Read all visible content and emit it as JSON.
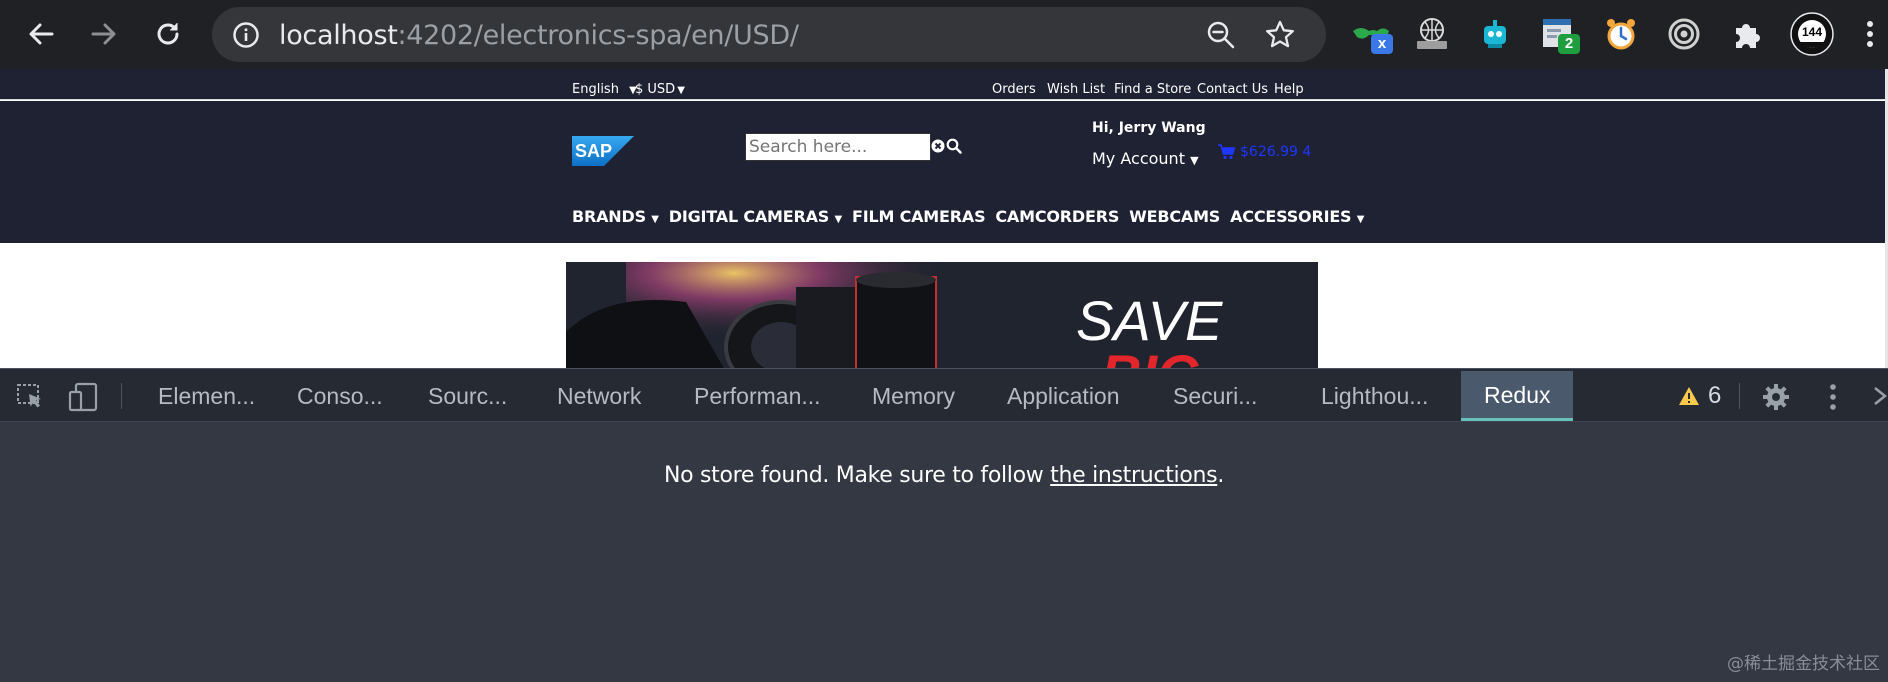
{
  "browser": {
    "url_host": "localhost",
    "url_rest": ":4202/electronics-spa/en/USD/",
    "extensions": [
      {
        "icon": "glasses-x-icon",
        "badge": "x",
        "badge_color": "#3b78e7"
      },
      {
        "icon": "globe-keyboard-icon",
        "badge": ""
      },
      {
        "icon": "robot-icon",
        "badge": ""
      },
      {
        "icon": "window-counter-icon",
        "badge": "2",
        "badge_color": "#1e9e3e"
      },
      {
        "icon": "alarm-clock-icon",
        "badge": ""
      },
      {
        "icon": "target-icon",
        "badge": ""
      },
      {
        "icon": "puzzle-icon",
        "badge": ""
      },
      {
        "icon": "avatar-icon",
        "badge": "144"
      }
    ]
  },
  "site": {
    "language": "English",
    "currency": "$ USD",
    "links": [
      "Orders",
      "Wish List",
      "Find a Store",
      "Contact Us",
      "Help"
    ],
    "logo_text": "SAP",
    "search_placeholder": "Search here...",
    "greeting": "Hi, Jerry Wang",
    "account_label": "My Account",
    "cart_total": "$626.99 4",
    "categories": [
      "BRANDS",
      "DIGITAL CAMERAS",
      "FILM CAMERAS",
      "CAMCORDERS",
      "WEBCAMS",
      "ACCESSORIES"
    ],
    "banner_headline_1": "SAVE",
    "banner_headline_2": "BIG"
  },
  "devtools": {
    "tabs": [
      "Elemen...",
      "Conso...",
      "Sourc...",
      "Network",
      "Performan...",
      "Memory",
      "Application",
      "Securi...",
      "Lighthou..."
    ],
    "active_tab": "Redux",
    "warning_count": "6",
    "message_pre": "No store found. Make sure to follow ",
    "message_link": "the instructions",
    "message_post": "."
  },
  "watermark": "@稀土掘金技术社区",
  "colors": {
    "chrome_bg": "#202124",
    "omnibox_bg": "#35363a",
    "site_header": "#1f2233",
    "devtools_bg": "#333842",
    "devtools_toolbar": "#262b33",
    "redux_tab": "#4a5a6c",
    "redux_underline": "#69c0b9",
    "warning": "#f9c94b"
  }
}
